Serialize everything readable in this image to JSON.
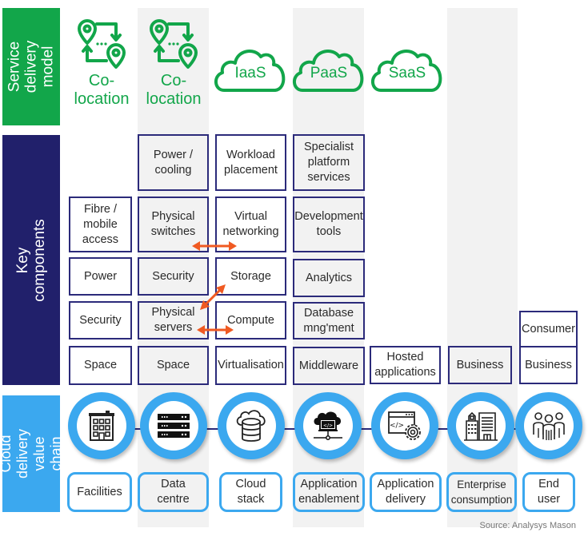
{
  "bands": {
    "service_delivery_model": "Service\ndelivery model",
    "key_components": "Key\ncomponents",
    "cloud_delivery_value_chain": "Cloud delivery\nvalue chain"
  },
  "service_models": [
    {
      "label": "Co-\nlocation",
      "icon": "colocation-pins-icon"
    },
    {
      "label": "Co-\nlocation",
      "icon": "colocation-pins-icon"
    },
    {
      "label": "IaaS",
      "icon": "cloud-icon"
    },
    {
      "label": "PaaS",
      "icon": "cloud-icon"
    },
    {
      "label": "SaaS",
      "icon": "cloud-icon"
    }
  ],
  "components": {
    "facilities": [
      "Fibre /\nmobile\naccess",
      "Power",
      "Security",
      "Space"
    ],
    "data_centre": [
      "Power /\ncooling",
      "Physical\nswitches",
      "Security",
      "Physical\nservers",
      "Space"
    ],
    "cloud_stack": [
      "Workload\nplacement",
      "Virtual\nnetworking",
      "Storage",
      "Compute",
      "Virtualisation"
    ],
    "application_enablement": [
      "Specialist\nplatform\nservices",
      "Development\ntools",
      "Analytics",
      "Database\nmng'ment",
      "Middleware"
    ],
    "application_delivery": [
      "Hosted\napplications"
    ],
    "enterprise_consumption": [
      "Business"
    ],
    "end_user": [
      "Consumer",
      "Business"
    ]
  },
  "value_chain": [
    {
      "label": "Facilities",
      "icon": "building-icon"
    },
    {
      "label": "Data\ncentre",
      "icon": "server-rack-icon"
    },
    {
      "label": "Cloud\nstack",
      "icon": "cloud-database-icon"
    },
    {
      "label": "Application\nenablement",
      "icon": "cloud-laptop-network-icon"
    },
    {
      "label": "Application\ndelivery",
      "icon": "code-window-gear-icon"
    },
    {
      "label": "Enterprise\nconsumption",
      "icon": "office-buildings-icon"
    },
    {
      "label": "End\nuser",
      "icon": "users-group-icon"
    }
  ],
  "source": "Source: Analysys Mason",
  "colors": {
    "green": "#12a64a",
    "navy": "#21206b",
    "blue": "#3ba8ef",
    "arrow": "#f05a22",
    "shade": "#f2f2f2"
  }
}
